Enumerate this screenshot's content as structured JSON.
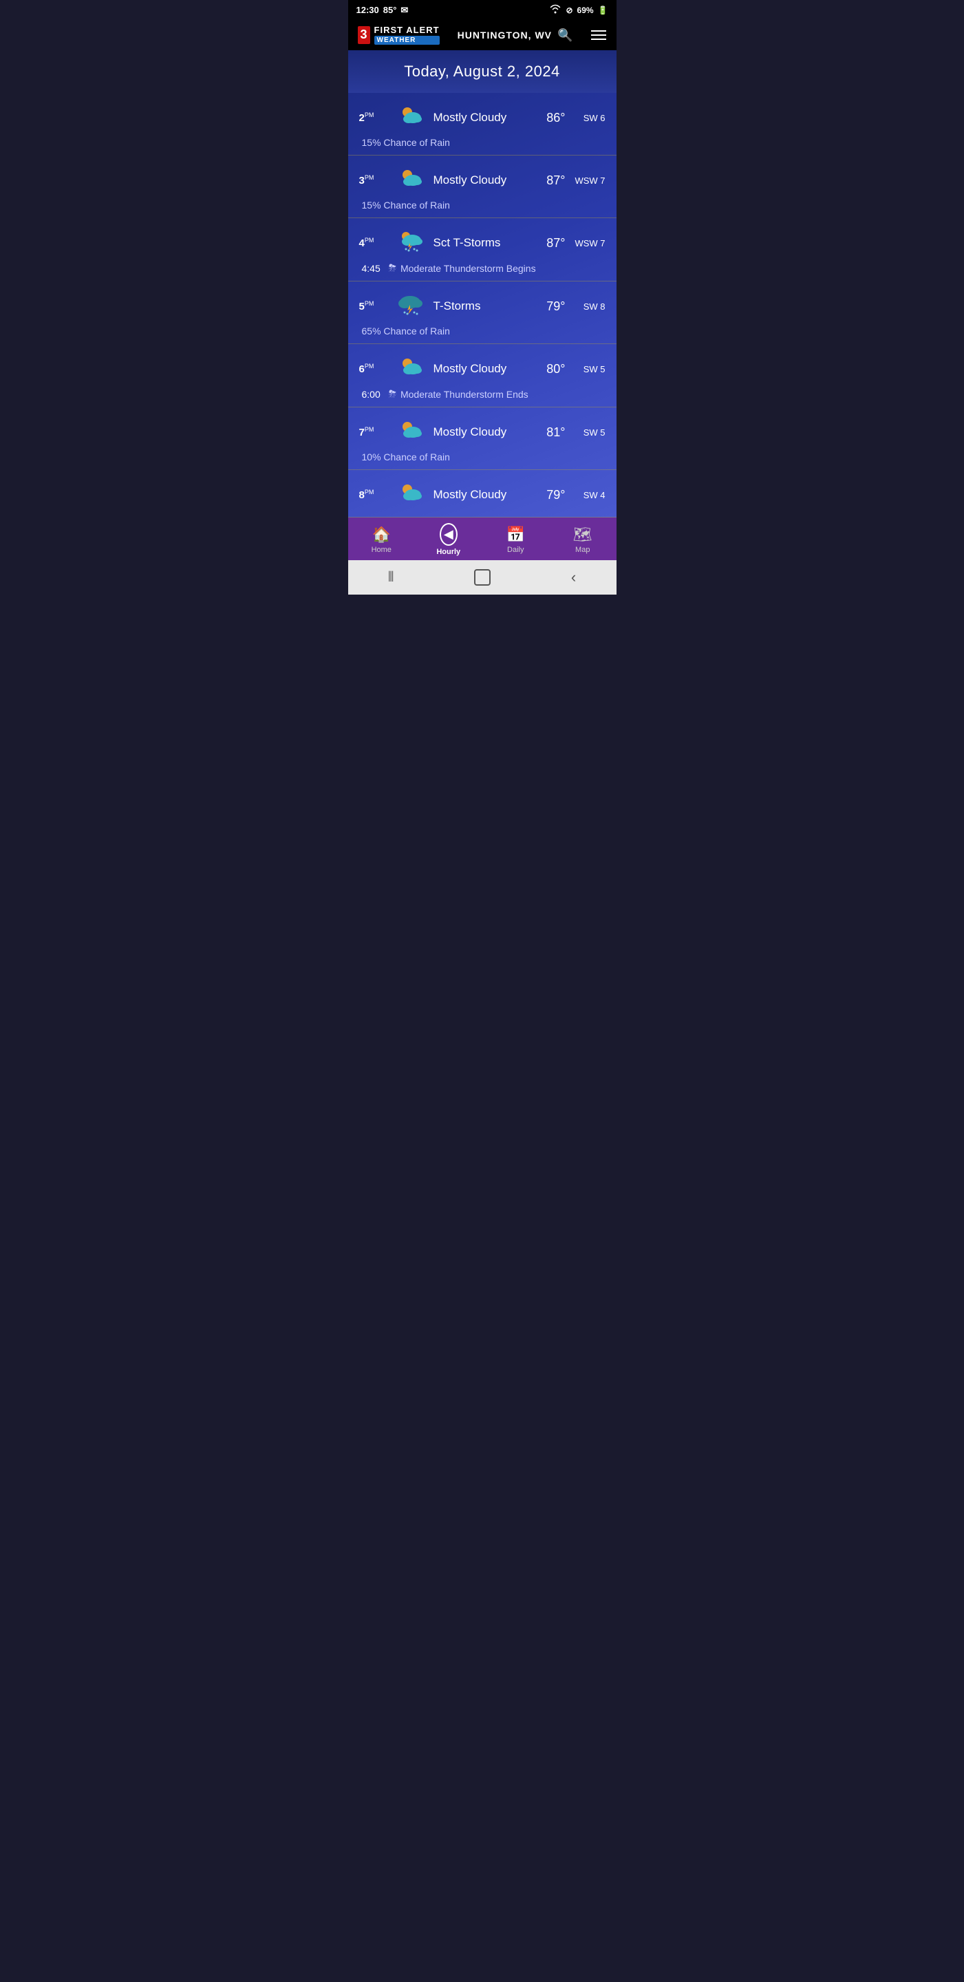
{
  "statusBar": {
    "time": "12:30",
    "temp": "85°",
    "wifi": "wifi",
    "battery": "69%"
  },
  "header": {
    "logo_num": "3",
    "logo_first": "FIRST ALERT",
    "logo_weather": "WEATHER",
    "location": "HUNTINGTON, WV",
    "menu_icon": "≡"
  },
  "dateBanner": {
    "text": "Today, August 2, 2024"
  },
  "hourlyRows": [
    {
      "time": "2",
      "period": "PM",
      "desc": "Mostly Cloudy",
      "temp": "86°",
      "wind": "SW 6",
      "detail": "15% Chance of Rain",
      "detailIcon": null,
      "iconType": "mostly-cloudy"
    },
    {
      "time": "3",
      "period": "PM",
      "desc": "Mostly Cloudy",
      "temp": "87°",
      "wind": "WSW 7",
      "detail": "15% Chance of Rain",
      "detailIcon": null,
      "iconType": "mostly-cloudy"
    },
    {
      "time": "4",
      "period": "PM",
      "desc": "Sct T-Storms",
      "temp": "87°",
      "wind": "WSW 7",
      "detail": "Moderate Thunderstorm Begins",
      "detailTime": "4:45",
      "detailIcon": "⛈",
      "iconType": "sct-tstorm"
    },
    {
      "time": "5",
      "period": "PM",
      "desc": "T-Storms",
      "temp": "79°",
      "wind": "SW 8",
      "detail": "65% Chance of Rain",
      "detailIcon": null,
      "iconType": "tstorm"
    },
    {
      "time": "6",
      "period": "PM",
      "desc": "Mostly Cloudy",
      "temp": "80°",
      "wind": "SW 5",
      "detail": "Moderate Thunderstorm Ends",
      "detailTime": "6:00",
      "detailIcon": "⛈",
      "iconType": "mostly-cloudy"
    },
    {
      "time": "7",
      "period": "PM",
      "desc": "Mostly Cloudy",
      "temp": "81°",
      "wind": "SW 5",
      "detail": "10% Chance of Rain",
      "detailIcon": null,
      "iconType": "mostly-cloudy"
    },
    {
      "time": "8",
      "period": "PM",
      "desc": "Mostly Cloudy",
      "temp": "79°",
      "wind": "SW 4",
      "detail": "",
      "detailIcon": null,
      "iconType": "mostly-cloudy"
    }
  ],
  "bottomNav": {
    "items": [
      {
        "label": "Home",
        "icon": "🏠",
        "active": false
      },
      {
        "label": "Hourly",
        "icon": "◀",
        "active": true
      },
      {
        "label": "Daily",
        "icon": "📅",
        "active": false
      },
      {
        "label": "Map",
        "icon": "🗺",
        "active": false
      }
    ]
  },
  "systemNav": {
    "back": "‹",
    "home": "☐",
    "recent": "⦀"
  }
}
